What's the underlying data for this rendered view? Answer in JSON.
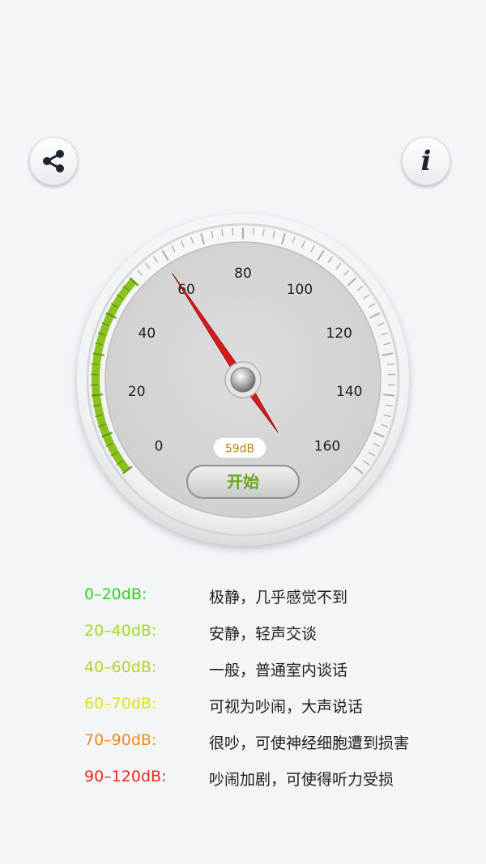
{
  "toolbar": {
    "share_icon": "share-icon",
    "info_icon": "info-icon",
    "info_glyph": "i"
  },
  "gauge": {
    "scale_labels": [
      "0",
      "20",
      "40",
      "60",
      "80",
      "100",
      "120",
      "140",
      "160"
    ],
    "current_value_db": 59,
    "reading_label": "59dB",
    "start_button_label": "开始",
    "colors": {
      "face": "#d5d5d5",
      "needle": "#d81a1a",
      "active_arc": "#8cc220",
      "reading_text": "#b8860b",
      "start_text": "#6aa621"
    }
  },
  "legend": [
    {
      "range": "0–20dB:",
      "description": "极静，几乎感觉不到",
      "color": "#2fd11e"
    },
    {
      "range": "20–40dB:",
      "description": "安静，轻声交谈",
      "color": "#a6d81e"
    },
    {
      "range": "40–60dB:",
      "description": "一般，普通室内谈话",
      "color": "#b7d51e"
    },
    {
      "range": "60–70dB:",
      "description": "可视为吵闹，大声说话",
      "color": "#e6de18"
    },
    {
      "range": "70–90dB:",
      "description": "很吵，可使神经细胞遭到损害",
      "color": "#f08a1a"
    },
    {
      "range": "90–120dB:",
      "description": "吵闹加剧，可使得听力受损",
      "color": "#e82a1c"
    }
  ]
}
